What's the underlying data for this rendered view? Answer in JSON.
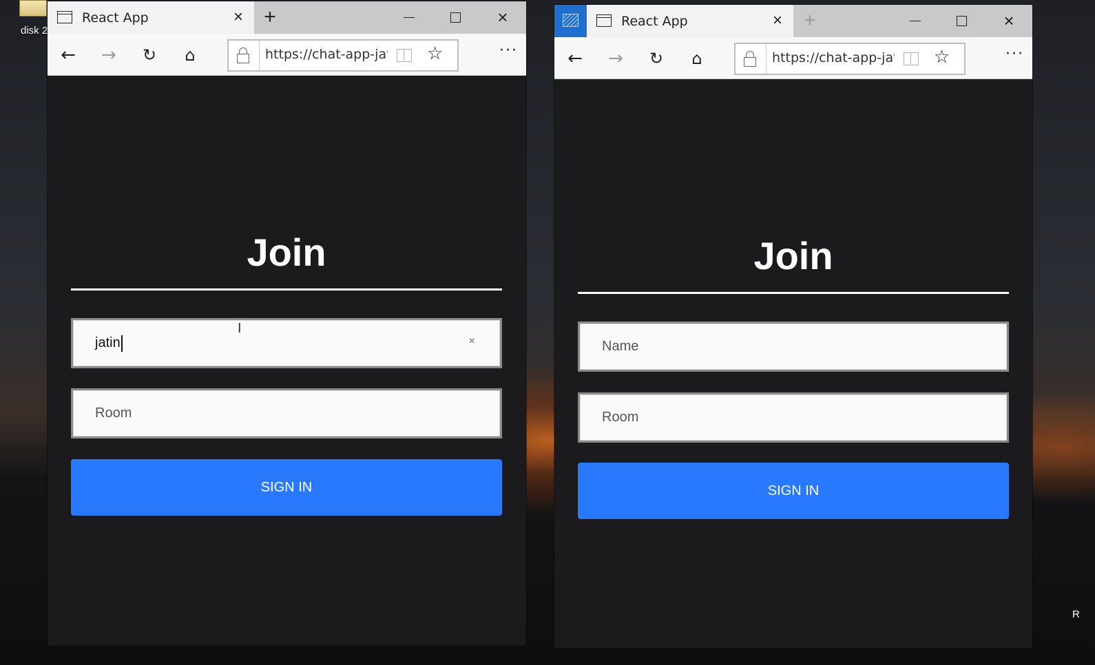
{
  "desktop": {
    "icon_label": "disk 2",
    "right_label": "R"
  },
  "windows": [
    {
      "tab_title": "React App",
      "url": "https://chat-app-jatin",
      "join": {
        "title": "Join",
        "name_value": "jatin",
        "name_placeholder": "Name",
        "room_placeholder": "Room",
        "signin_label": "SIGN IN"
      }
    },
    {
      "tab_title": "React App",
      "url": "https://chat-app-jatin",
      "join": {
        "title": "Join",
        "name_value": "",
        "name_placeholder": "Name",
        "room_placeholder": "Room",
        "signin_label": "SIGN IN"
      }
    }
  ],
  "icons": {
    "close": "×",
    "new_tab": "+",
    "back": "←",
    "forward": "→",
    "reload": "↻",
    "home": "⌂",
    "favorite": "☆",
    "more": "···",
    "clear": "×"
  },
  "colors": {
    "app_background": "#1b1b1e",
    "signin_button": "#2979ff",
    "text_primary": "#ffffff"
  }
}
